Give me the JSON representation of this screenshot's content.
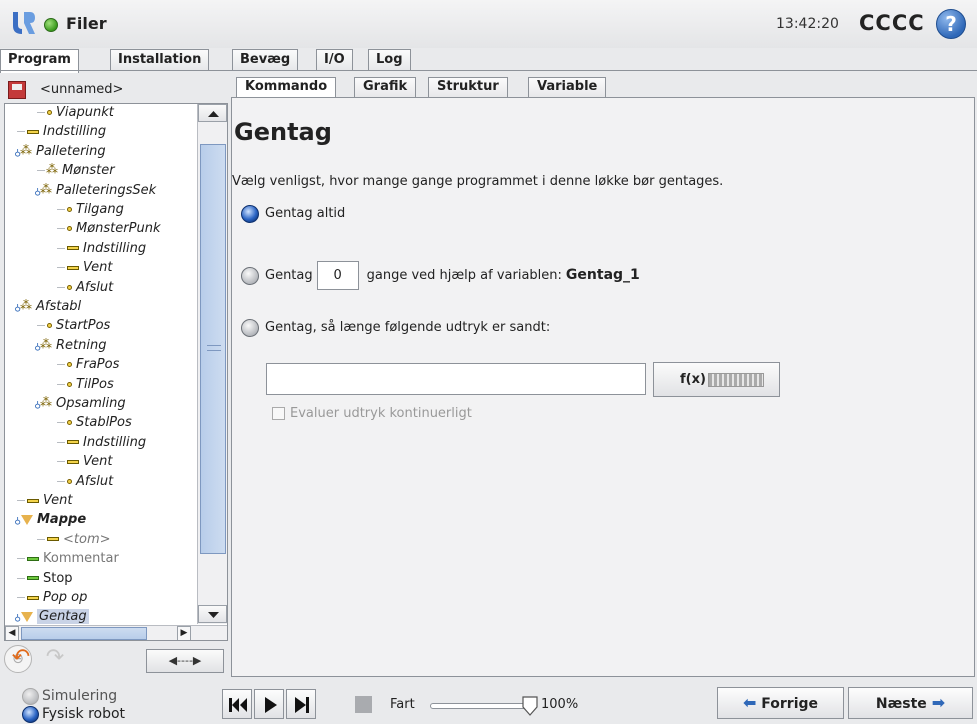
{
  "header": {
    "app_title": "Filer",
    "clock": "13:42:20",
    "robot_name": "CCCC",
    "help_label": "?"
  },
  "top_tabs": [
    {
      "label": "Program",
      "active": true
    },
    {
      "label": "Installation",
      "active": false
    },
    {
      "label": "Bevæg",
      "active": false
    },
    {
      "label": "I/O",
      "active": false
    },
    {
      "label": "Log",
      "active": false
    }
  ],
  "program": {
    "name": "<unnamed>"
  },
  "tree": [
    {
      "label": "Viapunkt",
      "icon": "waypoint-icon",
      "style": "italic"
    },
    {
      "label": "Indstilling",
      "icon": "set-icon",
      "style": "italic"
    },
    {
      "label": "Palletering",
      "icon": "pallet-icon",
      "style": "italic"
    },
    {
      "label": "Mønster",
      "icon": "pallet-icon",
      "style": "italic"
    },
    {
      "label": "PalleteringsSek",
      "icon": "pallet-icon",
      "style": "italic"
    },
    {
      "label": "Tilgang",
      "icon": "waypoint-icon",
      "style": "italic"
    },
    {
      "label": "MønsterPunk",
      "icon": "waypoint-icon",
      "style": "italic"
    },
    {
      "label": "Indstilling",
      "icon": "set-icon",
      "style": "italic"
    },
    {
      "label": "Vent",
      "icon": "set-icon",
      "style": "italic"
    },
    {
      "label": "Afslut",
      "icon": "waypoint-icon",
      "style": "italic"
    },
    {
      "label": "Afstabl",
      "icon": "pallet-icon",
      "style": "italic"
    },
    {
      "label": "StartPos",
      "icon": "waypoint-icon",
      "style": "italic"
    },
    {
      "label": "Retning",
      "icon": "pallet-icon",
      "style": "italic"
    },
    {
      "label": "FraPos",
      "icon": "waypoint-icon",
      "style": "italic"
    },
    {
      "label": "TilPos",
      "icon": "waypoint-icon",
      "style": "italic"
    },
    {
      "label": "Opsamling",
      "icon": "pallet-icon",
      "style": "italic"
    },
    {
      "label": "StablPos",
      "icon": "waypoint-icon",
      "style": "italic"
    },
    {
      "label": "Indstilling",
      "icon": "set-icon",
      "style": "italic"
    },
    {
      "label": "Vent",
      "icon": "set-icon",
      "style": "italic"
    },
    {
      "label": "Afslut",
      "icon": "waypoint-icon",
      "style": "italic"
    },
    {
      "label": "Vent",
      "icon": "set-icon",
      "style": "italic"
    },
    {
      "label": "Mappe",
      "icon": "folder-icon",
      "style": "bold-italic"
    },
    {
      "label": "<tom>",
      "icon": "set-icon",
      "style": "gray-italic"
    },
    {
      "label": "Kommentar",
      "icon": "comment-icon",
      "style": "gray"
    },
    {
      "label": "Stop",
      "icon": "stop-icon",
      "style": "normal"
    },
    {
      "label": "Pop op",
      "icon": "set-icon",
      "style": "italic"
    },
    {
      "label": "Gentag",
      "icon": "folder-icon",
      "style": "italic-selected"
    }
  ],
  "tree_buttons": {
    "move_label": "◀----▶"
  },
  "sub_tabs": [
    {
      "label": "Kommando",
      "active": true
    },
    {
      "label": "Grafik",
      "active": false
    },
    {
      "label": "Struktur",
      "active": false
    },
    {
      "label": "Variable",
      "active": false
    }
  ],
  "command": {
    "title": "Gentag",
    "instructions": "Vælg venligst, hvor mange gange programmet i denne løkke bør gentages.",
    "option_always": "Gentag altid",
    "option_count_prefix": "Gentag",
    "repeat_count": "0",
    "option_count_suffix": "gange ved hjælp af variablen:",
    "variable_name": "Gentag_1",
    "option_expression": "Gentag, så længe følgende udtryk er sandt:",
    "expression_value": "",
    "fx_label": "f(x)",
    "eval_label": "Evaluer udtryk kontinuerligt",
    "selected_option": "always"
  },
  "bottom": {
    "simulation_label": "Simulering",
    "real_robot_label": "Fysisk robot",
    "speed_label": "Fart",
    "speed_value": "100%",
    "speed_fraction": 1.0,
    "prev_label": "Forrige",
    "next_label": "Næste"
  }
}
